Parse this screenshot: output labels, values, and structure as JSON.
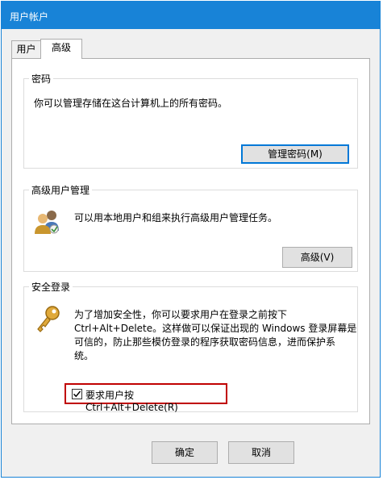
{
  "window": {
    "title": "用户帐户"
  },
  "tabs": [
    {
      "label": "用户"
    },
    {
      "label": "高级"
    }
  ],
  "password_group": {
    "title": "密码",
    "description": "你可以管理存储在这台计算机上的所有密码。",
    "button": "管理密码(M)"
  },
  "advanced_group": {
    "title": "高级用户管理",
    "description": "可以用本地用户和组来执行高级用户管理任务。",
    "button": "高级(V)"
  },
  "secure_group": {
    "title": "安全登录",
    "description_lines": [
      "为了增加安全性，你可以要求用户在登录之前按下",
      "Ctrl+Alt+Delete。这样做可以保证出现的 Windows 登录屏幕是",
      "可信的，防止那些模仿登录的程序获取密码信息，进而保护系",
      "统。"
    ],
    "checkbox_label": "要求用户按 Ctrl+Alt+Delete(R)",
    "checkbox_checked": true
  },
  "footer": {
    "ok": "确定",
    "cancel": "取消"
  },
  "colors": {
    "titlebar": "#1883d7",
    "highlight": "#c00000",
    "focus": "#0078d7"
  }
}
